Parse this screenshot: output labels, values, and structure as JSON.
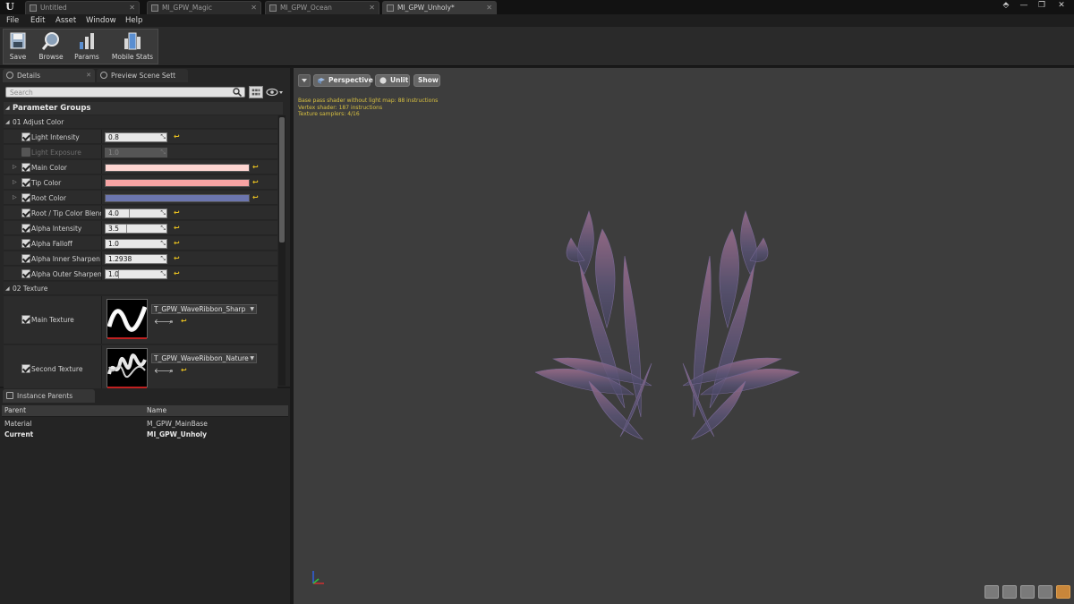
{
  "app": {
    "logo": "U"
  },
  "document_tabs": [
    {
      "label": "Untitled",
      "active": false
    },
    {
      "label": "MI_GPW_Magic",
      "active": false
    },
    {
      "label": "MI_GPW_Ocean",
      "active": false
    },
    {
      "label": "MI_GPW_Unholy*",
      "active": true
    }
  ],
  "window_controls": {
    "minimize": "—",
    "maximize": "❐",
    "close": "✕"
  },
  "menu": [
    "File",
    "Edit",
    "Asset",
    "Window",
    "Help"
  ],
  "toolbar": {
    "save": "Save",
    "browse": "Browse",
    "params": "Params",
    "mobile_stats": "Mobile Stats"
  },
  "details_tabs": {
    "details": "Details",
    "preview_scene": "Preview Scene Sett"
  },
  "search": {
    "placeholder": "Search"
  },
  "parameter_groups": {
    "title": "Parameter Groups",
    "group1": "01 Adjust Color",
    "group2": "02 Texture",
    "params": [
      {
        "label": "Light Intensity",
        "value": "0.8",
        "checked": true,
        "enabled": true
      },
      {
        "label": "Light Exposure",
        "value": "1.0",
        "checked": false,
        "enabled": false
      },
      {
        "label": "Main Color",
        "color": "#ffd6d2",
        "checked": true
      },
      {
        "label": "Tip Color",
        "color": "#f7a3a3",
        "checked": true
      },
      {
        "label": "Root Color",
        "color": "#6c76ae",
        "checked": true
      },
      {
        "label": "Root / Tip Color Blend",
        "value": "4.0",
        "checked": true,
        "enabled": true
      },
      {
        "label": "Alpha Intensity",
        "value": "3.5",
        "checked": true,
        "enabled": true
      },
      {
        "label": "Alpha Falloff",
        "value": "1.0",
        "checked": true,
        "enabled": true
      },
      {
        "label": "Alpha Inner Sharpen",
        "value": "1.2938",
        "checked": true,
        "enabled": true
      },
      {
        "label": "Alpha Outer Sharpen",
        "value": "1.0",
        "checked": true,
        "enabled": true
      }
    ],
    "textures": [
      {
        "label": "Main Texture",
        "asset": "T_GPW_WaveRibbon_Sharp",
        "checked": true
      },
      {
        "label": "Second Texture",
        "asset": "T_GPW_WaveRibbon_Nature",
        "checked": true
      }
    ]
  },
  "instance_parents": {
    "tab": "Instance Parents",
    "col_parent": "Parent",
    "col_name": "Name",
    "rows": [
      {
        "parent": "Material",
        "name": "M_GPW_MainBase",
        "bold": false
      },
      {
        "parent": "Current",
        "name": "MI_GPW_Unholy",
        "bold": true
      }
    ]
  },
  "viewport": {
    "perspective": "Perspective",
    "unlit": "Unlit",
    "show": "Show",
    "stats": [
      "Base pass shader without light map: 88 instructions",
      "Vertex shader: 187 instructions",
      "Texture samplers: 4/16"
    ]
  },
  "colors": {
    "accent_orange": "#c8863a",
    "reset_yellow": "#e8c020",
    "mesh_purple": "#6a5a8a"
  }
}
